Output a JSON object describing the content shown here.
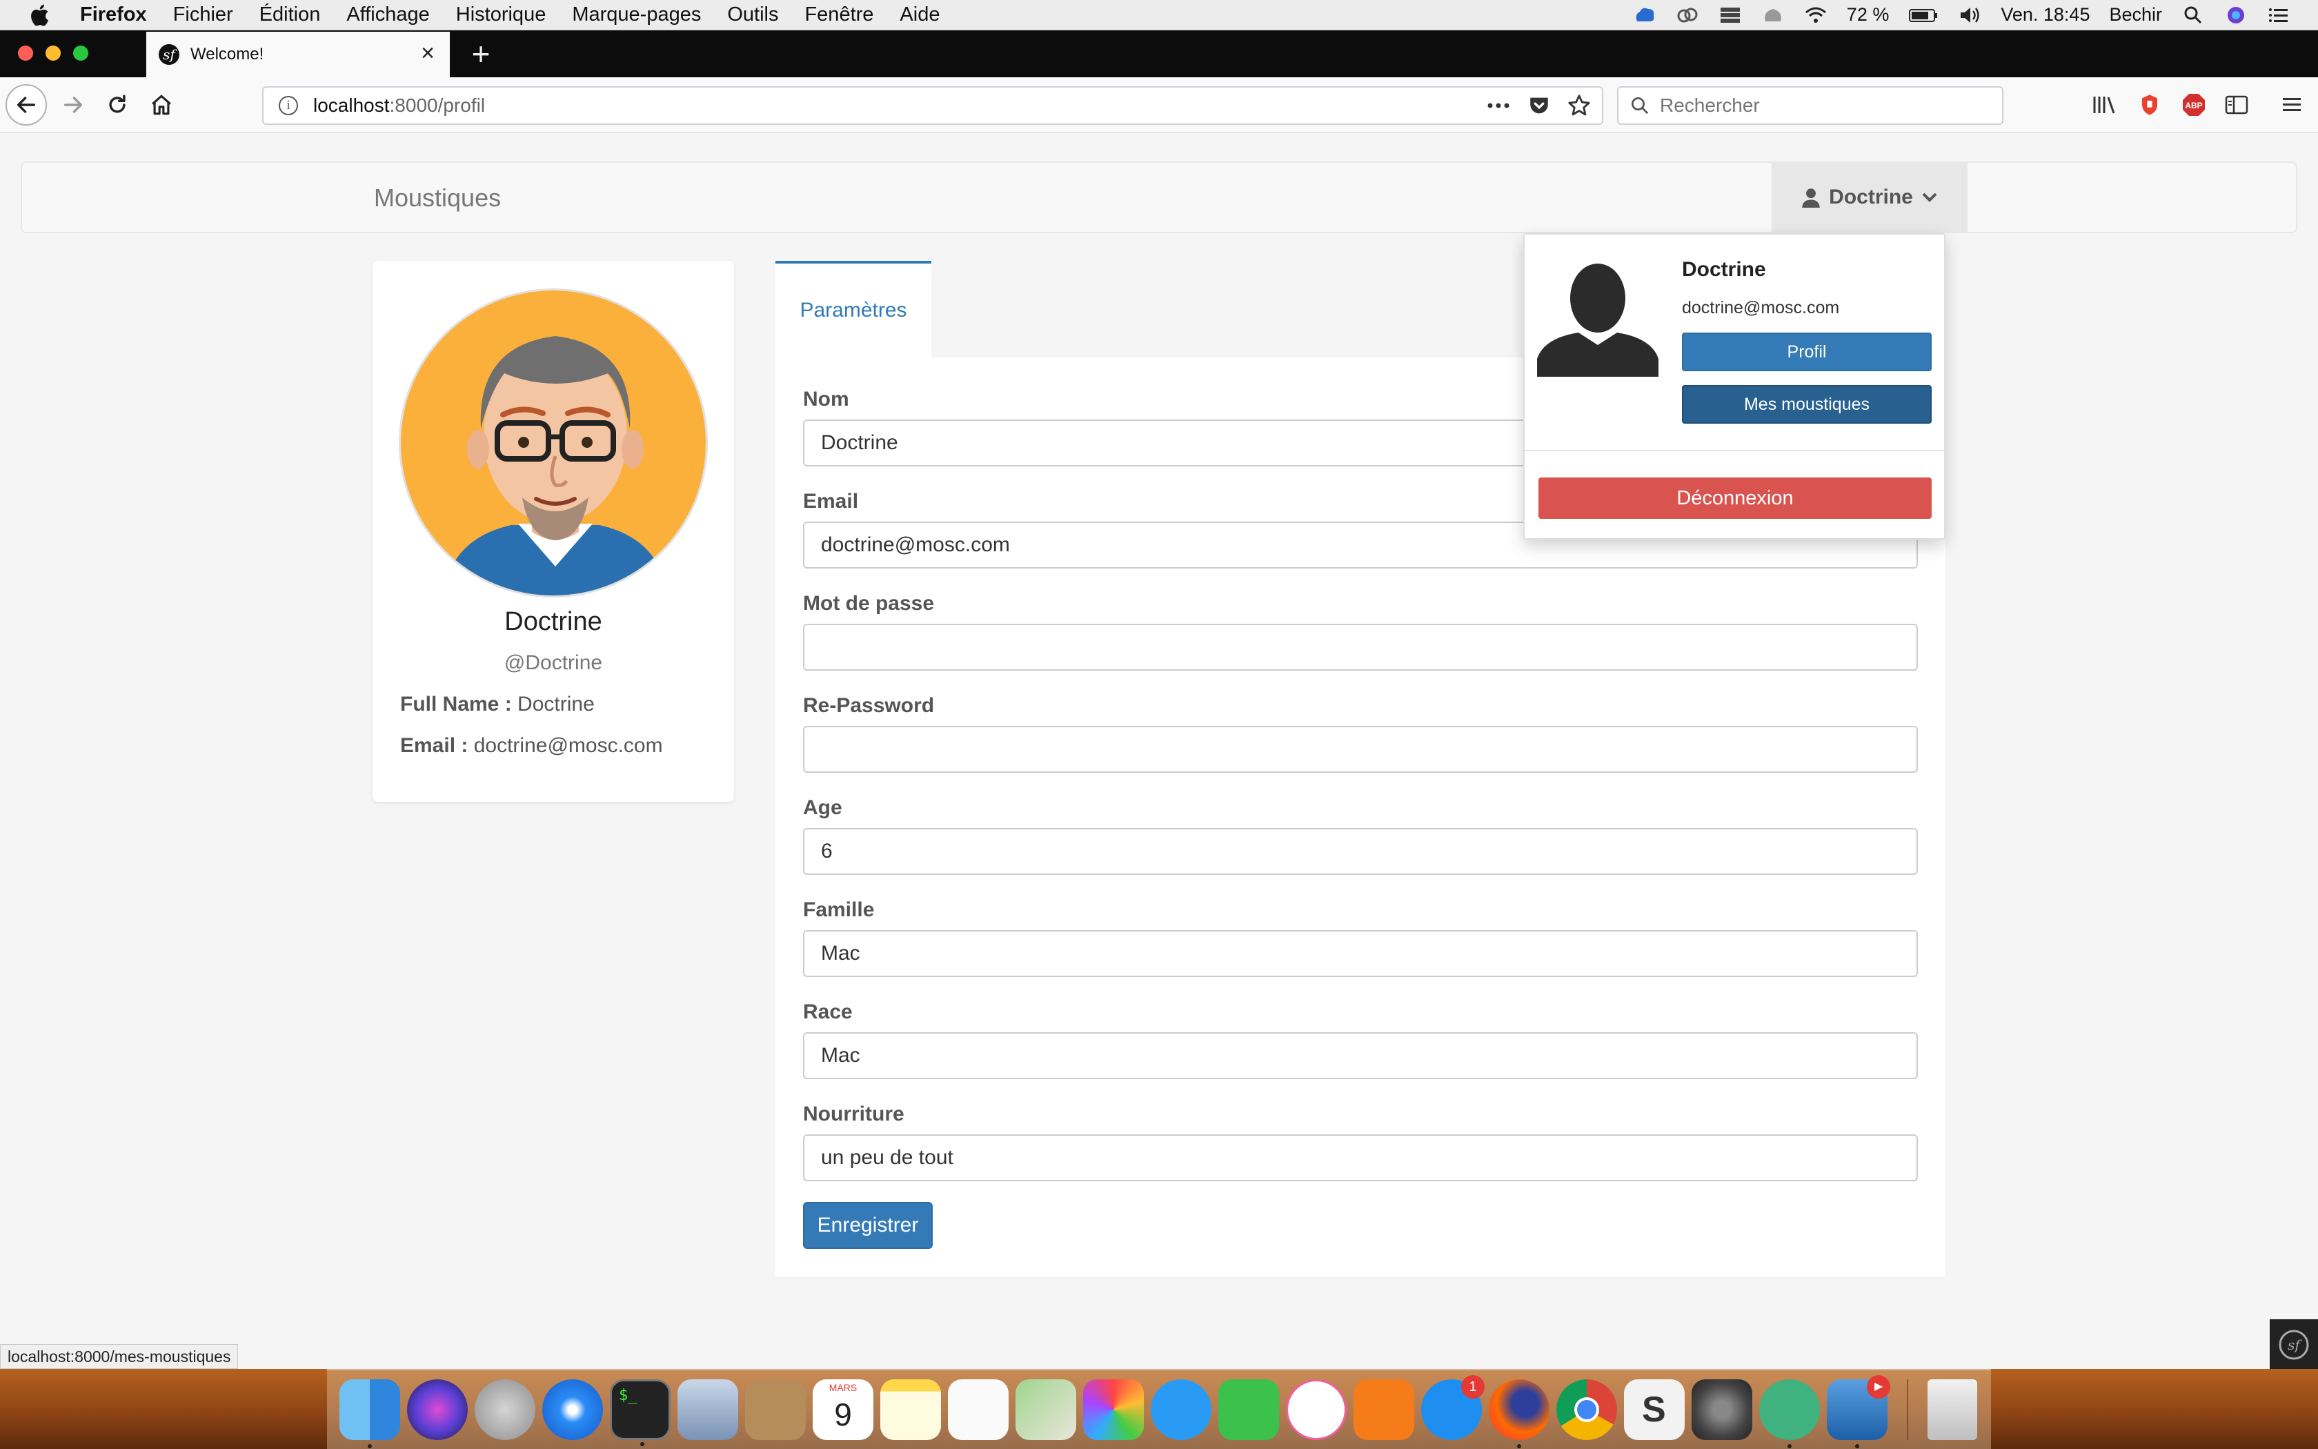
{
  "menubar": {
    "app": "Firefox",
    "items": [
      "Fichier",
      "Édition",
      "Affichage",
      "Historique",
      "Marque-pages",
      "Outils",
      "Fenêtre",
      "Aide"
    ],
    "battery": "72 %",
    "clock": "Ven. 18:45",
    "user": "Bechir"
  },
  "browser": {
    "tab_title": "Welcome!",
    "url_host": "localhost",
    "url_path": ":8000/profil",
    "search_placeholder": "Rechercher",
    "status_url": "localhost:8000/mes-moustiques"
  },
  "site": {
    "brand": "Moustiques",
    "user_menu_label": "Doctrine"
  },
  "profile_card": {
    "name": "Doctrine",
    "handle": "@Doctrine",
    "fullname_label": "Full Name :",
    "fullname_value": "Doctrine",
    "email_label": "Email :",
    "email_value": "doctrine@mosc.com"
  },
  "form": {
    "tab": "Paramètres",
    "fields": [
      {
        "label": "Nom",
        "value": ""
      },
      {
        "label": "Email",
        "value": "doctrine@mosc.com"
      },
      {
        "label": "Mot de passe",
        "value": ""
      },
      {
        "label": "Re-Password",
        "value": ""
      },
      {
        "label": "Age",
        "value": "6"
      },
      {
        "label": "Famille",
        "value": "Mac"
      },
      {
        "label": "Race",
        "value": "Mac"
      },
      {
        "label": "Nourriture",
        "value": "un peu de tout"
      }
    ],
    "nom_value": "Doctrine",
    "submit": "Enregistrer"
  },
  "dropdown": {
    "name": "Doctrine",
    "email": "doctrine@mosc.com",
    "profile_button": "Profil",
    "mosquitoes_button": "Mes moustiques",
    "logout_button": "Déconnexion"
  },
  "dock": {
    "calendar_month": "MARS",
    "calendar_day": "9",
    "appstore_badge": "1"
  },
  "colors": {
    "primary": "#337ab7",
    "primary_dark": "#286090",
    "danger": "#d9534f"
  }
}
